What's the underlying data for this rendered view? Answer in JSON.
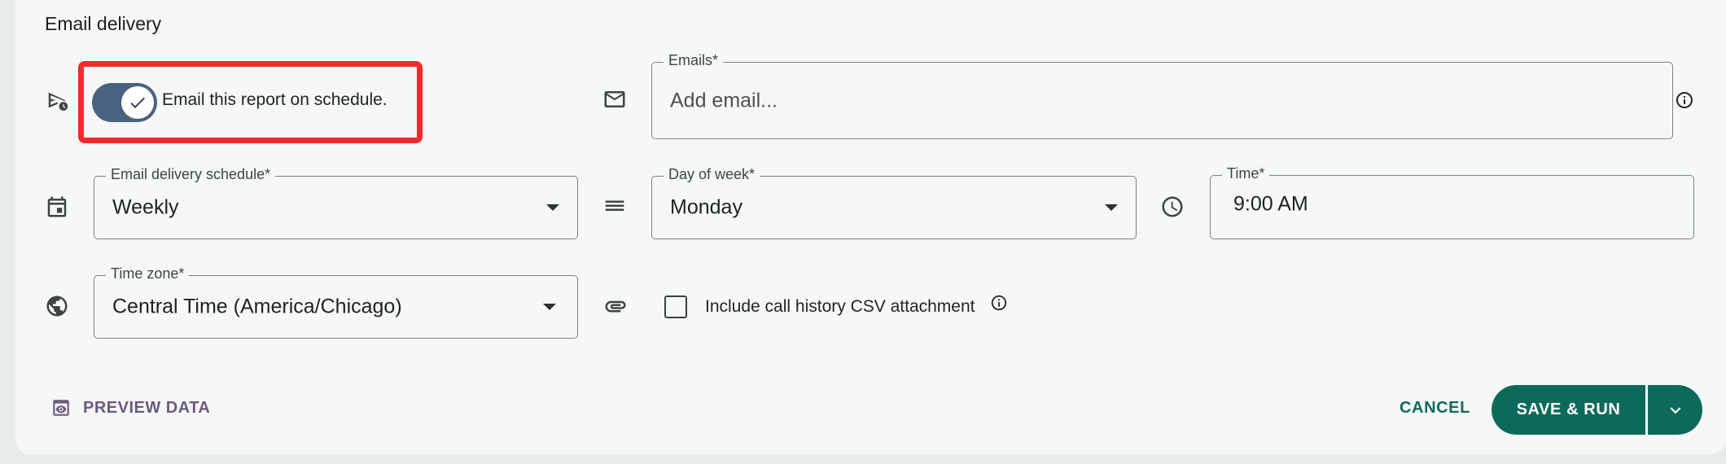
{
  "section": {
    "title": "Email delivery"
  },
  "toggle": {
    "label": "Email this report on schedule.",
    "checked": true
  },
  "emails": {
    "label": "Emails*",
    "placeholder": "Add email..."
  },
  "schedule": {
    "label": "Email delivery schedule*",
    "value": "Weekly"
  },
  "day_of_week": {
    "label": "Day of week*",
    "value": "Monday"
  },
  "time": {
    "label": "Time*",
    "value": "9:00 AM"
  },
  "timezone": {
    "label": "Time zone*",
    "value": "Central Time (America/Chicago)"
  },
  "attachment": {
    "label": "Include call history CSV attachment",
    "checked": false
  },
  "actions": {
    "preview_label": "PREVIEW DATA",
    "cancel_label": "CANCEL",
    "save_label": "SAVE & RUN"
  },
  "colors": {
    "accent": "#0d6a5b",
    "toggle": "#4a6280",
    "preview": "#6c5a80",
    "highlight": "#f02b2b"
  },
  "icons": {
    "schedule_send": "schedule-send-icon",
    "mail": "mail-icon",
    "calendar": "calendar-icon",
    "list": "list-icon",
    "clock": "clock-icon",
    "globe": "globe-icon",
    "attachment": "paperclip-icon",
    "info": "info-icon",
    "preview": "preview-icon",
    "chevron": "chevron-down-icon"
  }
}
